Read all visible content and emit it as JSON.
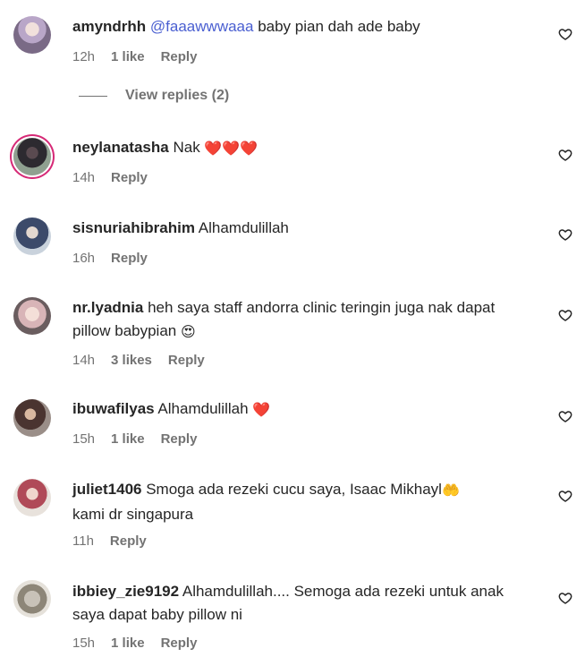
{
  "comments": [
    {
      "username": "amyndrhh",
      "mention": "@faaawwwaaa",
      "text": " baby pian dah ade baby",
      "time": "12h",
      "likes": "1 like",
      "reply": "Reply"
    },
    {
      "username": "neylanatasha",
      "text": " Nak ",
      "emoji": "❤️❤️❤️",
      "time": "14h",
      "reply": "Reply"
    },
    {
      "username": "sisnuriahibrahim",
      "text": " Alhamdulillah",
      "time": "16h",
      "reply": "Reply"
    },
    {
      "username": "nr.lyadnia",
      "text": " heh saya staff andorra clinic teringin juga nak dapat pillow babypian ",
      "emoji": "😍",
      "time": "14h",
      "likes": "3 likes",
      "reply": "Reply"
    },
    {
      "username": "ibuwafilyas",
      "text": " Alhamdulillah ",
      "emoji": "❤️",
      "time": "15h",
      "likes": "1 like",
      "reply": "Reply"
    },
    {
      "username": "juliet1406",
      "text": " Smoga ada rezeki cucu saya, Isaac Mikhayl",
      "emoji": "🤲",
      "text2": "kami dr singapura",
      "time": "11h",
      "reply": "Reply"
    },
    {
      "username": "ibbiey_zie9192",
      "text": " Alhamdulillah.... Semoga ada rezeki untuk anak saya dapat baby pillow ni",
      "time": "15h",
      "likes": "1 like",
      "reply": "Reply"
    }
  ],
  "view_replies": "View replies (2)",
  "icons": {
    "like": "heart-outline-icon"
  },
  "colors": {
    "mention": "#4a5fd1",
    "meta": "#737373",
    "text": "#262626",
    "story_ring": "#d62976"
  }
}
